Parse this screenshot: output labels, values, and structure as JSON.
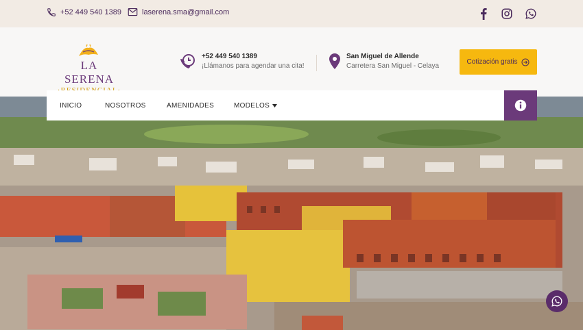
{
  "topbar": {
    "phone": "+52 449 540 1389",
    "email": "laserena.sma@gmail.com",
    "social": [
      "facebook-icon",
      "instagram-icon",
      "whatsapp-icon"
    ]
  },
  "logo": {
    "line1": "LA SERENA",
    "line2": "·RESIDENCIAL·"
  },
  "contact_phone": {
    "title": "+52 449 540 1389",
    "subtitle": "¡Llámanos para agendar una cita!"
  },
  "contact_location": {
    "title": "San Miguel de Allende",
    "subtitle": "Carretera San Miguel - Celaya"
  },
  "cta": {
    "label": "Cotización gratis"
  },
  "nav": {
    "items": [
      "INICIO",
      "NOSOTROS",
      "AMENIDADES",
      "MODELOS"
    ]
  },
  "colors": {
    "brand_purple": "#6b3a7a",
    "brand_yellow": "#f6b80f",
    "topbar_bg": "#f2ebe4"
  }
}
